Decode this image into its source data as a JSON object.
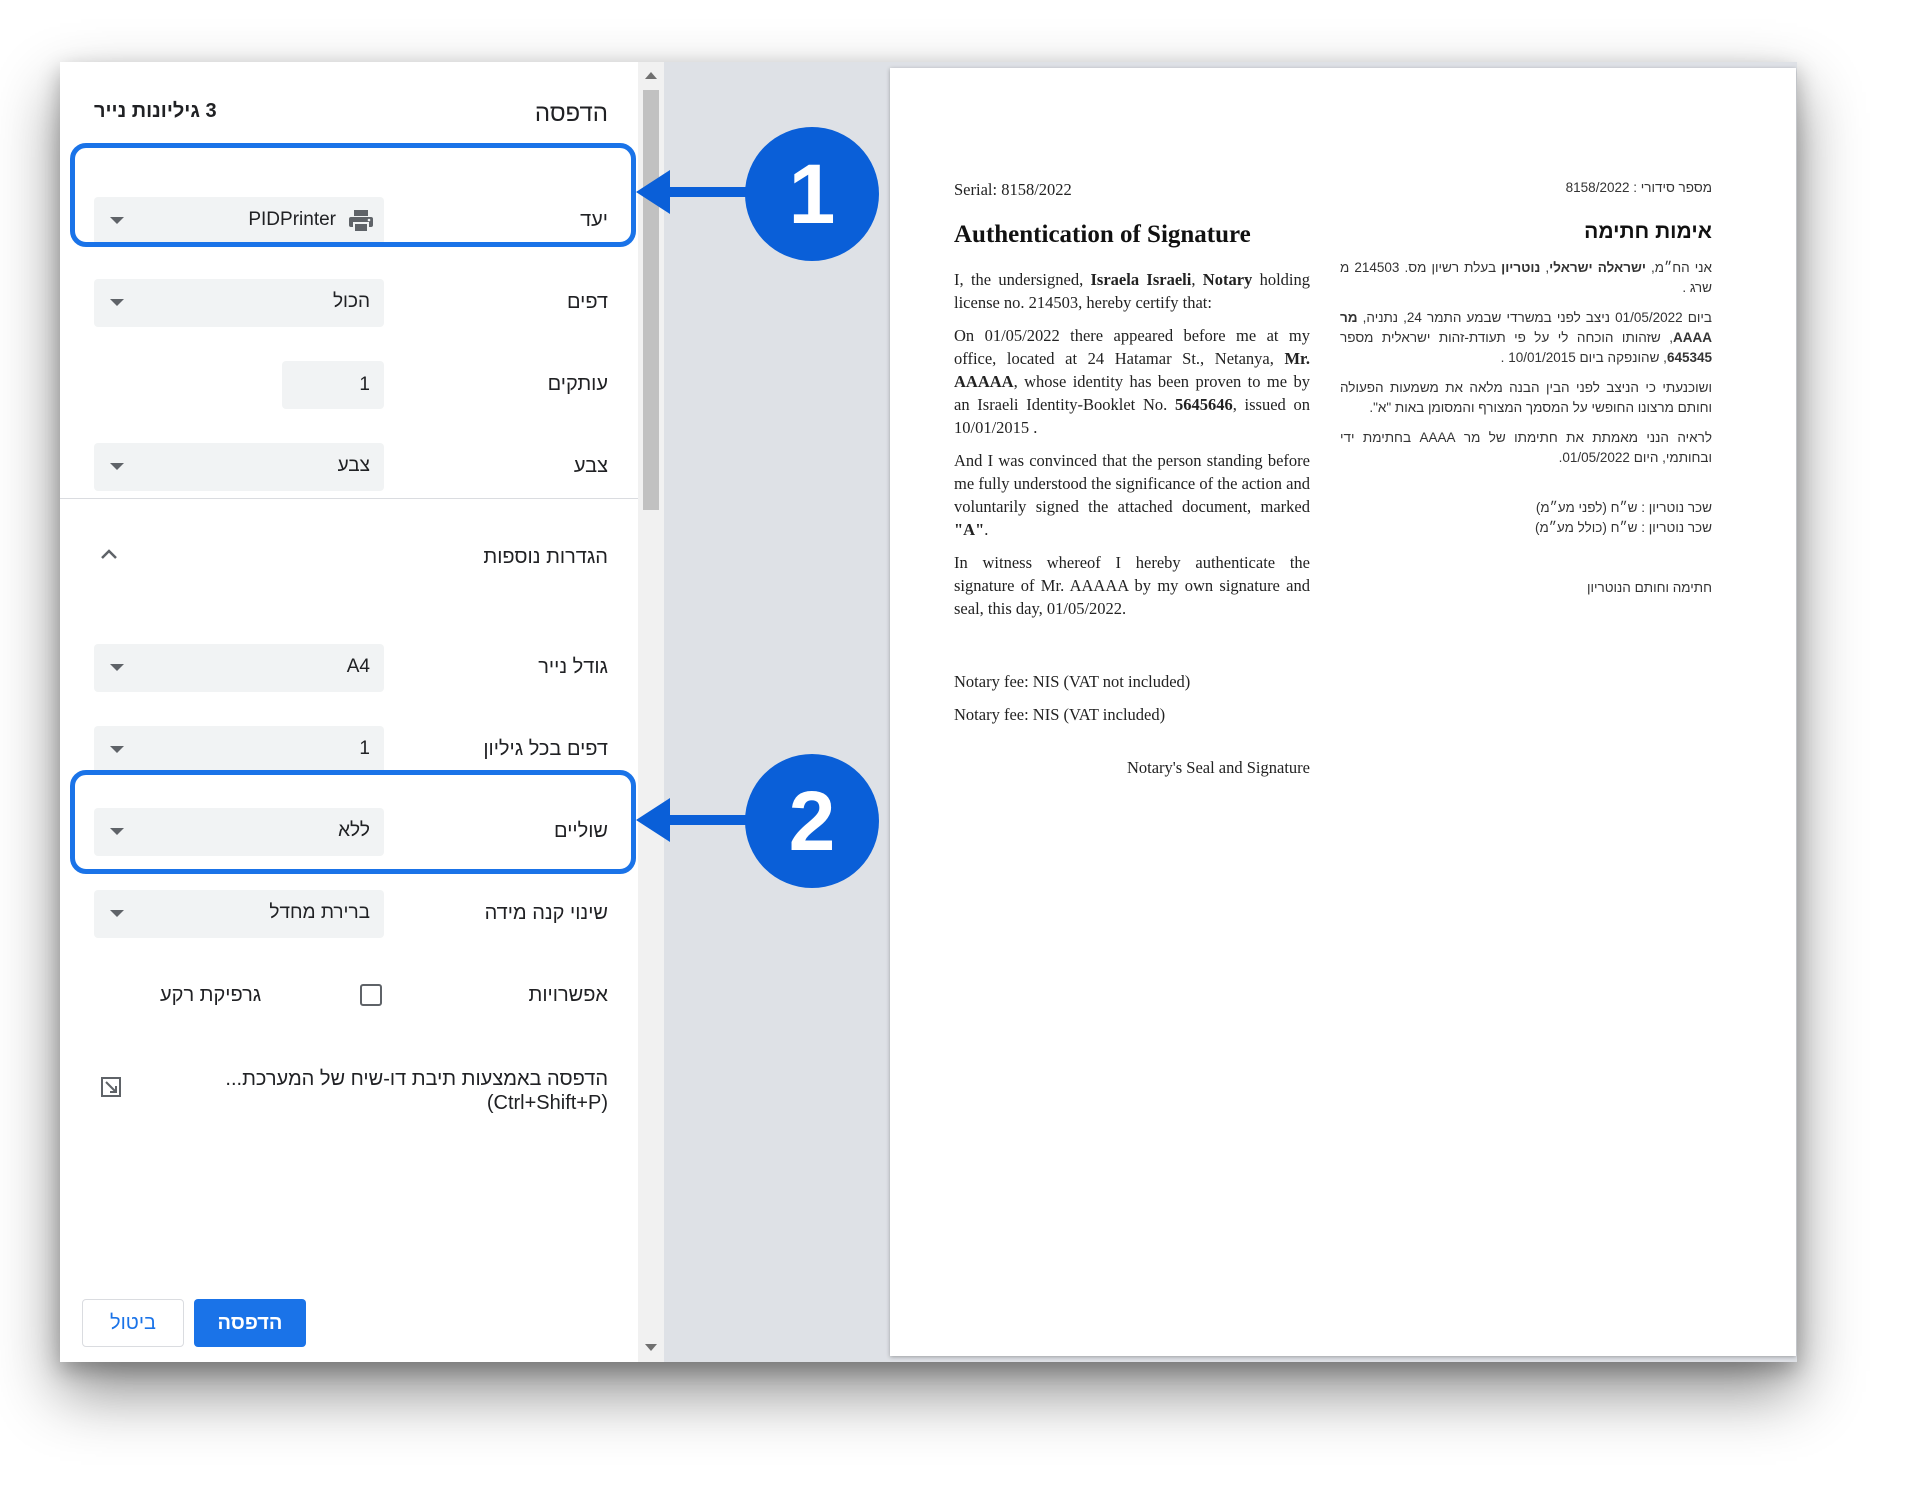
{
  "print_panel": {
    "title": "הדפסה",
    "sheets": "3 גיליונות נייר",
    "destination": {
      "label": "יעד",
      "value": "PIDPrinter",
      "icon": "printer-icon"
    },
    "pages": {
      "label": "דפים",
      "value": "הכול"
    },
    "copies": {
      "label": "עותקים",
      "value": "1"
    },
    "color": {
      "label": "צבע",
      "value": "צבע"
    },
    "more_settings": {
      "label": "הגדרות נוספות"
    },
    "paper_size": {
      "label": "גודל נייר",
      "value": "A4"
    },
    "pages_per_sheet": {
      "label": "דפים בכל גיליון",
      "value": "1"
    },
    "margins": {
      "label": "שוליים",
      "value": "ללא"
    },
    "scale": {
      "label": "שינוי קנה מידה",
      "value": "ברירת מחדל"
    },
    "options": {
      "label": "אפשרויות",
      "background_graphics": "גרפיקת רקע"
    },
    "system_dialog": {
      "line1": "הדפסה באמצעות תיבת דו-שיח של המערכת...",
      "line2": "(Ctrl+Shift+P)"
    },
    "print_button": "הדפסה",
    "cancel_button": "ביטול"
  },
  "callouts": {
    "one": "1",
    "two": "2"
  },
  "colors": {
    "accent": "#1a73e8",
    "callout": "#0a5fd8",
    "preview_bg": "#dee1e6"
  },
  "document": {
    "en": {
      "serial": "Serial: 8158/2022",
      "title": "Authentication of Signature",
      "p1": {
        "a": "I, the undersigned, ",
        "name": "Israela Israeli",
        "b": ", ",
        "role": "Notary",
        "c": " holding license no. 214503, hereby certify that:"
      },
      "p2": {
        "a": "On 01/05/2022 there appeared before me at my office, located at 24 Hatamar St., Netanya, ",
        "mr": "Mr. AAAAA",
        "b": ", whose identity has been proven to me by an Israeli Identity-Booklet No. ",
        "id": "5645646",
        "c": ", issued on 10/01/2015 ."
      },
      "p3": {
        "a": "And I was convinced that the person standing before me fully understood the significance of the action and voluntarily signed the attached document, marked ",
        "mark": "\"A\"",
        "b": "."
      },
      "p4": "In witness whereof I hereby authenticate the signature of Mr. AAAAA by my own signature and seal, this day, 01/05/2022.",
      "fee1": "Notary fee: NIS (VAT not included)",
      "fee2": "Notary fee: NIS (VAT included)",
      "seal": "Notary's Seal and Signature"
    },
    "he": {
      "serial": "מספר סידורי : 8158/2022",
      "title": "אימות חתימה",
      "p1": {
        "a": "אני הח״מ, ",
        "name": "ישראלה ישראלי",
        "b": ", ",
        "role": "נוטריון",
        "c": " בעלת רשיון מס. 214503 מ שרג ."
      },
      "p2": {
        "a": "ביום 01/05/2022 ניצב לפני במשרדי שבמע התמר 24, נתניה, ",
        "mr": "מר AAAA",
        "b": ", שזהותו הוכחה לי על פי תעודת-זהות ישראלית מספר ",
        "id": "645345",
        "c": ", שהונפקה ביום 10/01/2015 ."
      },
      "p3": "ושוכנעתי כי הניצב לפני הבין הבנה מלאה את משמעות הפעולה וחותם מרצונו החופשי על המסמך המצורף והמסומן באות \"א\".",
      "p4": "לראיה הנני מאמתת את חתימתו של מר AAAA בחתימת ידי ובחותמי, היום 01/05/2022.",
      "fee1": "שכר נוטריון : ש״ח (לפני מע״מ)",
      "fee2": "שכר נוטריון : ש״ח (כולל מע״מ)",
      "sign": "חתימה וחותם הנוטריון"
    }
  }
}
